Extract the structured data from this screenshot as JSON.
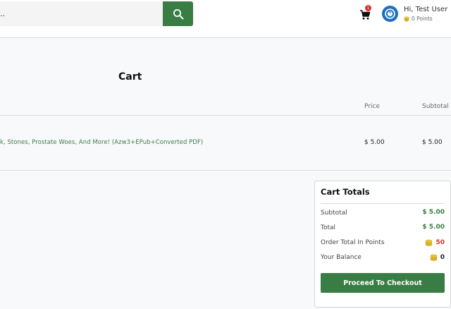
{
  "header": {
    "search": {
      "value": "ks..",
      "placeholder": ""
    },
    "cart": {
      "count": "1"
    },
    "user": {
      "greeting": "Hi, Test User",
      "points": "0 Points"
    }
  },
  "cart": {
    "title": "Cart",
    "columns": {
      "price": "Price",
      "subtotal": "Subtotal"
    },
    "items": [
      {
        "name": "k, Stones, Prostate Woes, And More! (Azw3+EPub+Converted PDF)",
        "price": "$ 5.00",
        "subtotal": "$ 5.00"
      }
    ]
  },
  "totals": {
    "title": "Cart Totals",
    "rows": [
      {
        "label": "Subtotal",
        "value": "$ 5.00"
      },
      {
        "label": "Total",
        "value": "$ 5.00"
      },
      {
        "label": "Order Total In Points",
        "value": "50"
      },
      {
        "label": "Your Balance",
        "value": "0"
      }
    ],
    "checkout_label": "Proceed To Checkout"
  },
  "colors": {
    "accent": "#3a7d44",
    "badge": "#e52b2b",
    "avatar": "#1e6fbf",
    "points": "#d8312a",
    "coin": "#e0b422"
  },
  "icons": [
    "search-icon",
    "cart-icon",
    "power-icon",
    "coins-icon"
  ]
}
